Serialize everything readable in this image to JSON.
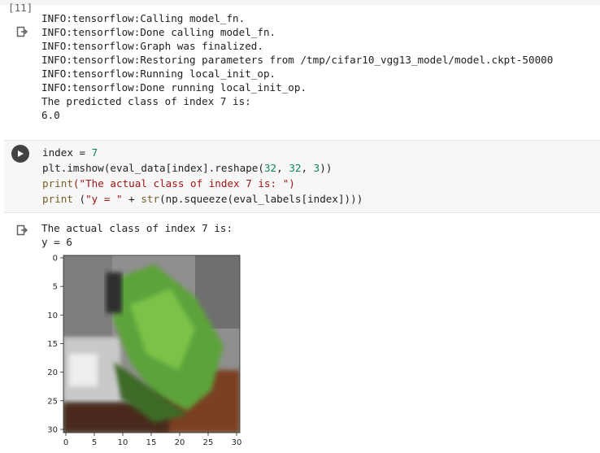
{
  "cell_prev": {
    "execution_count": "[11]",
    "output_lines": [
      "INFO:tensorflow:Calling model_fn.",
      "INFO:tensorflow:Done calling model_fn.",
      "INFO:tensorflow:Graph was finalized.",
      "INFO:tensorflow:Restoring parameters from /tmp/cifar10_vgg13_model/model.ckpt-50000",
      "INFO:tensorflow:Running local_init_op.",
      "INFO:tensorflow:Done running local_init_op.",
      "The predicted class of index 7 is:",
      "6.0"
    ]
  },
  "cell_code": {
    "line1": {
      "a": "index = ",
      "b": "7"
    },
    "line2": {
      "a": "plt.imshow(eval_data[index].reshape(",
      "n1": "32",
      "c1": ", ",
      "n2": "32",
      "c2": ", ",
      "n3": "3",
      "d": "))"
    },
    "line3": {
      "fn": "print",
      "s": "(\"The actual class of index 7 is: \")"
    },
    "line4": {
      "fn": "print",
      "a": " (",
      "s": "\"y = \"",
      "b": " + ",
      "fn2": "str",
      "c": "(np.squeeze(eval_labels[index])))"
    }
  },
  "cell_output": {
    "lines": [
      "The actual class of index 7 is:",
      "y = 6"
    ]
  },
  "plot": {
    "ylim": [
      0,
      31
    ],
    "xlim": [
      0,
      31
    ],
    "yticks": [
      "0",
      "5",
      "10",
      "15",
      "20",
      "25",
      "30"
    ],
    "xticks": [
      "0",
      "5",
      "10",
      "15",
      "20",
      "25",
      "30"
    ],
    "image_description_colors": {
      "background": "#9a9a9a",
      "frog_green": "#5da33a",
      "dark_green": "#3d6b26",
      "brown": "#8a4a2a",
      "white": "#e8e8e8"
    }
  }
}
